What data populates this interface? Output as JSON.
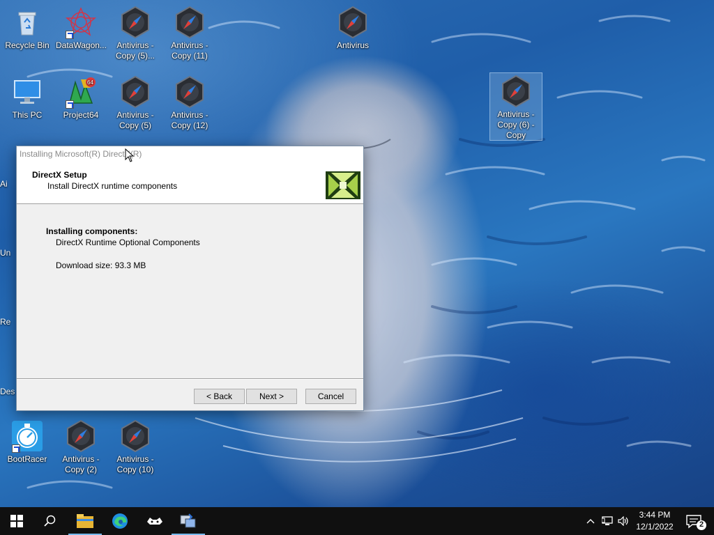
{
  "desktop_icons": [
    {
      "label": "Recycle Bin",
      "icon": "recycle-bin-icon"
    },
    {
      "label": "DataWagon...",
      "icon": "datawagon-icon"
    },
    {
      "label": "Antivirus - Copy (5)...",
      "icon": "antivirus-icon"
    },
    {
      "label": "Antivirus - Copy (11)",
      "icon": "antivirus-icon"
    },
    {
      "label": "Antivirus",
      "icon": "antivirus-icon"
    },
    {
      "label": "This PC",
      "icon": "this-pc-icon"
    },
    {
      "label": "Project64",
      "icon": "project64-icon"
    },
    {
      "label": "Antivirus - Copy (5)",
      "icon": "antivirus-icon"
    },
    {
      "label": "Antivirus - Copy (12)",
      "icon": "antivirus-icon"
    },
    {
      "label": "Antivirus - Copy (6) - Copy",
      "icon": "antivirus-icon"
    },
    {
      "label": "BootRacer",
      "icon": "bootracer-icon"
    },
    {
      "label": "Antivirus - Copy (2)",
      "icon": "antivirus-icon"
    },
    {
      "label": "Antivirus - Copy (10)",
      "icon": "antivirus-icon"
    }
  ],
  "partial_icons": [
    "Ai",
    "Un",
    "Re",
    "Des"
  ],
  "dialog": {
    "title": "Installing Microsoft(R) DirectX(R)",
    "header_title": "DirectX Setup",
    "header_subtitle": "Install DirectX runtime components",
    "section_title": "Installing components:",
    "component": "DirectX Runtime Optional Components",
    "download_size": "Download size: 93.3 MB",
    "back_label": "< Back",
    "next_label": "Next >",
    "cancel_label": "Cancel"
  },
  "taskbar": {
    "time": "3:44 PM",
    "date": "12/1/2022",
    "notification_count": "2"
  }
}
